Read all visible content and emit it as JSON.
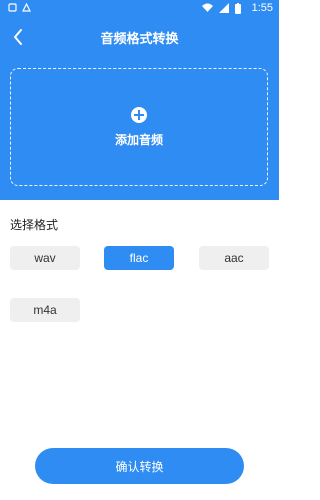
{
  "status_bar": {
    "time": "1:55"
  },
  "header": {
    "title": "音频格式转换"
  },
  "upload": {
    "label": "添加音频"
  },
  "formats": {
    "section_title": "选择格式",
    "options": [
      "wav",
      "flac",
      "aac",
      "m4a"
    ],
    "selected": "flac"
  },
  "actions": {
    "confirm_label": "确认转换"
  },
  "colors": {
    "accent": "#2f8cf2",
    "chip_bg": "#efefef"
  },
  "icons": {
    "back": "chevron-left-icon",
    "add": "plus-circle-icon",
    "status_left": [
      "notification-icon",
      "app-icon"
    ],
    "status_right": [
      "wifi-icon",
      "signal-icon",
      "battery-icon"
    ]
  }
}
